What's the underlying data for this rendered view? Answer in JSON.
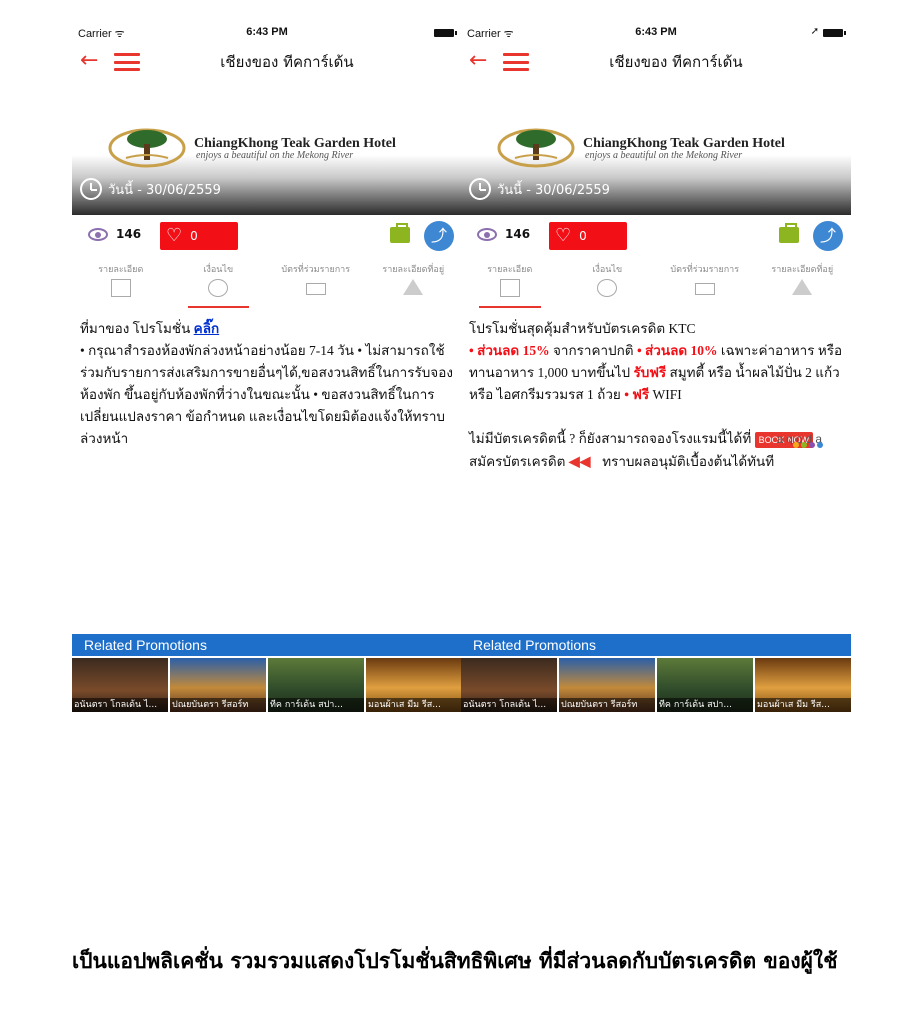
{
  "colors": {
    "accent": "#e8352e",
    "like": "#f20f16",
    "share": "#3d87d3",
    "bag": "#8cb51f",
    "related_bar": "#1d6fc9",
    "link": "#0030d0"
  },
  "screens": [
    {
      "status": {
        "carrier": "Carrier ᯤ",
        "time": "6:43 PM"
      },
      "nav": {
        "back_icon": "←",
        "title": "เชียงของ ทีคการ์เด้น"
      },
      "banner": {
        "hotel_name": "ChiangKhong Teak Garden Hotel",
        "tagline": "enjoys a beautiful on the Mekong River",
        "date": "วันนี้ - 30/06/2559"
      },
      "actions": {
        "views": "146",
        "likes": "0"
      },
      "tabs": [
        "รายละเอียด",
        "เงื่อนไข",
        "บัตรที่ร่วมรายการ",
        "รายละเอียดที่อยู่"
      ],
      "active_tab": 1,
      "content": {
        "lead": "ที่มาของ โปรโมชั่น ",
        "link": "คลิ๊ก",
        "body": "• กรุณาสำรองห้องพักล่วงหน้าอย่างน้อย 7-14 วัน • ไม่สามารถใช้ร่วมกับรายการส่งเสริมการขายอื่นๆได้,ขอสงวนสิทธิ์ในการรับจอง ห้องพัก ขึ้นอยู่กับห้องพักที่ว่างในขณะนั้น • ขอสงวนสิทธิ์ในการเปลี่ยนแปลงราคา ข้อกำหนด และเงื่อนไขโดยมิต้องแจ้งให้ทราบล่วงหน้า"
      },
      "related_title": "Related Promotions",
      "related": [
        "อนันตรา โกลเด้น ไ...",
        "ปณยบันตรา รีสอร์ท",
        "ทีค การ์เด้น สปา...",
        "มอนผ้าเส มีม รีส..."
      ]
    },
    {
      "status": {
        "carrier": "Carrier ᯤ",
        "time": "6:43 PM",
        "location_icon": "➚"
      },
      "nav": {
        "back_icon": "←",
        "title": "เชียงของ ทีคการ์เด้น"
      },
      "banner": {
        "hotel_name": "ChiangKhong Teak Garden Hotel",
        "tagline": "enjoys a beautiful on the Mekong River",
        "date": "วันนี้ - 30/06/2559"
      },
      "actions": {
        "views": "146",
        "likes": "0"
      },
      "tabs": [
        "รายละเอียด",
        "เงื่อนไข",
        "บัตรที่ร่วมรายการ",
        "รายละเอียดที่อยู่"
      ],
      "active_tab": 0,
      "content": {
        "line1": "โปรโมชั่นสุดคุ้มสำหรับบัตรเครดิต KTC",
        "bullet1_red": "• ส่วนลด 15%",
        "bullet1_rest": " จากราคาปกติ ",
        "bullet2_red": "• ส่วนลด 10%",
        "bullet2_rest": " เฉพาะค่าอาหาร หรือ ทานอาหาร 1,000 บาทขึ้นไป ",
        "free_drink_red": "รับฟรี",
        "free_drink_rest": " สมูทตี้ หรือ น้ำผลไม้ปั่น 2 แก้ว หรือ ไอศกรีมรวมรส 1 ถ้วย ",
        "wifi_red": "• ฟรี",
        "wifi_rest": " WIFI",
        "agoda_logo": "agoda",
        "no_card": "ไม่มีบัตรเครดิตนี้ ? ก็ยังสามารถจองโรงแรมนี้ได้ที่ ",
        "book_now": "BOOK NOW",
        "apply_lead": "สมัครบัตรเครดิต ",
        "apply_rest": " ทราบผลอนุมัติเบื้องต้นได้ทันที"
      },
      "related_title": "Related Promotions",
      "related": [
        "อนันตรา โกลเด้น ไ...",
        "ปณยบันตรา รีสอร์ท",
        "ทีค การ์เด้น สปา...",
        "มอนผ้าเส มีม รีส..."
      ]
    }
  ],
  "caption": "เป็นแอปพลิเคชั่น รวมรวมแสดงโปรโมชั่นสิทธิพิเศษ ที่มีส่วนลดกับบัตรเครดิต ของผู้ใช้"
}
